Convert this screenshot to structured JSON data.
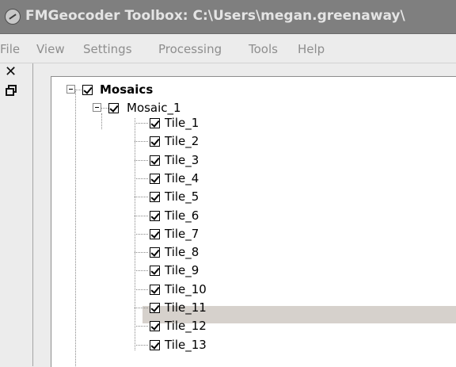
{
  "window": {
    "title": "FMGeocoder Toolbox: C:\\Users\\megan.greenaway\\"
  },
  "menu": [
    "File",
    "View",
    "Settings",
    "Processing",
    "Tools",
    "Help"
  ],
  "panel": {
    "close_glyph": "✕"
  },
  "tree": {
    "root": {
      "label": "Mosaics",
      "checked": true,
      "expanded": true
    },
    "mosaic": {
      "label": "Mosaic_1",
      "checked": true,
      "expanded": true
    },
    "tiles": [
      "Tile_1",
      "Tile_2",
      "Tile_3",
      "Tile_4",
      "Tile_5",
      "Tile_6",
      "Tile_7",
      "Tile_8",
      "Tile_9",
      "Tile_10",
      "Tile_11",
      "Tile_12",
      "Tile_13"
    ],
    "selected": "Tile_11"
  },
  "icons": {
    "app": "app-globe-icon",
    "close": "close-icon",
    "restore": "restore-window-icon"
  }
}
